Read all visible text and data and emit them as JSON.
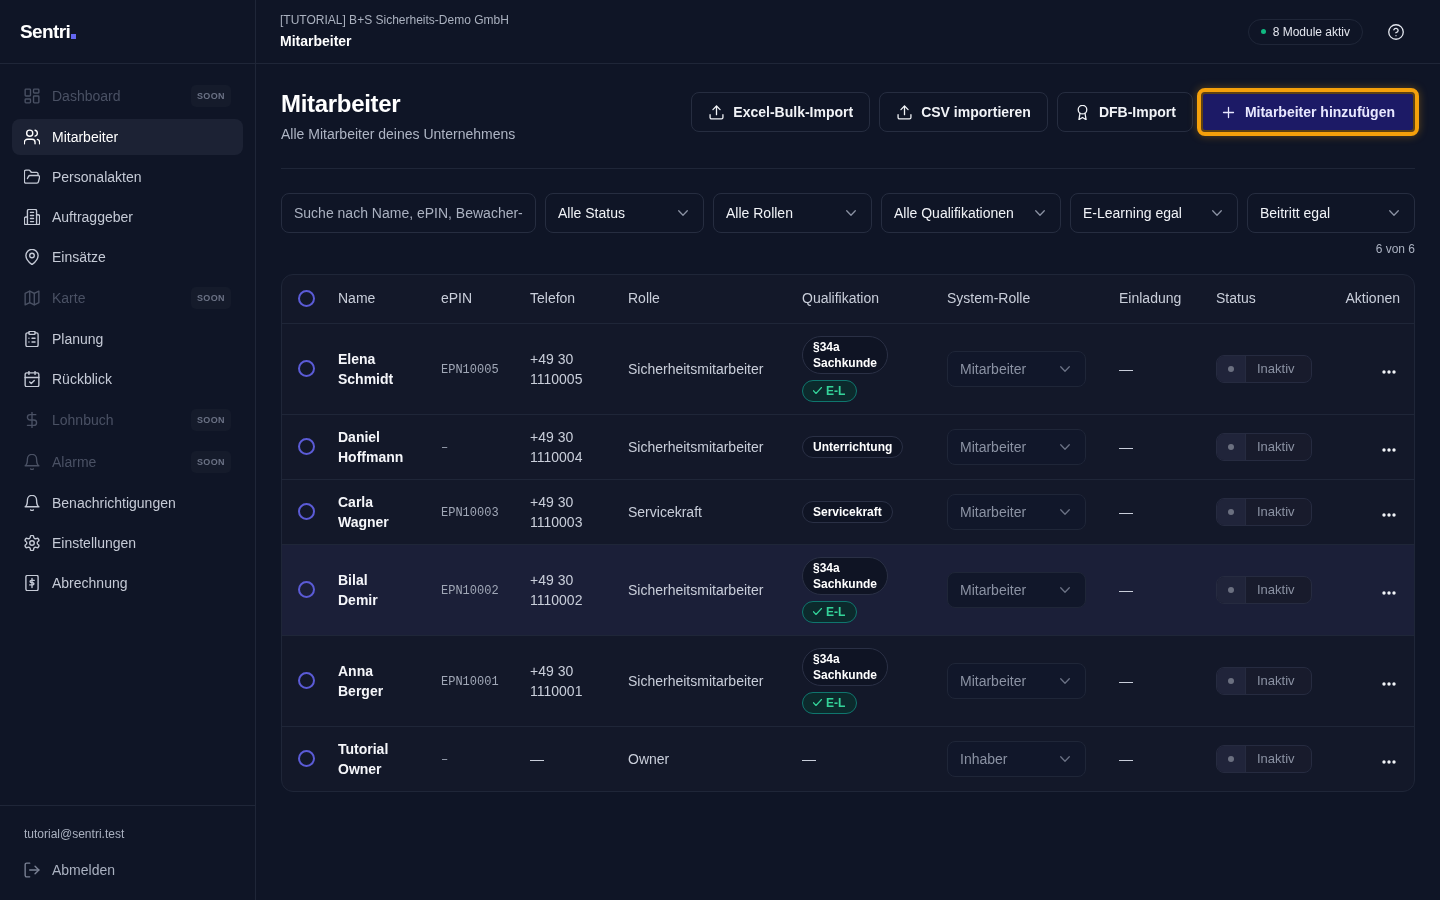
{
  "sidebar": {
    "logo": "Sentri",
    "items": [
      {
        "label": "Dashboard",
        "selected": false,
        "disabled": true,
        "badge": "SOON"
      },
      {
        "label": "Mitarbeiter",
        "selected": true,
        "disabled": false
      },
      {
        "label": "Personalakten",
        "selected": false,
        "disabled": false
      },
      {
        "label": "Auftraggeber",
        "selected": false,
        "disabled": false
      },
      {
        "label": "Einsätze",
        "selected": false,
        "disabled": false
      },
      {
        "label": "Karte",
        "selected": false,
        "disabled": true,
        "badge": "SOON"
      },
      {
        "label": "Planung",
        "selected": false,
        "disabled": false
      },
      {
        "label": "Rückblick",
        "selected": false,
        "disabled": false
      },
      {
        "label": "Lohnbuch",
        "selected": false,
        "disabled": true,
        "badge": "SOON"
      },
      {
        "label": "Alarme",
        "selected": false,
        "disabled": true,
        "badge": "SOON"
      },
      {
        "label": "Benachrichtigungen",
        "selected": false,
        "disabled": false
      },
      {
        "label": "Einstellungen",
        "selected": false,
        "disabled": false
      },
      {
        "label": "Abrechnung",
        "selected": false,
        "disabled": false
      }
    ],
    "user_email": "tutorial@sentri.test",
    "logout": "Abmelden"
  },
  "topbar": {
    "company": "[TUTORIAL] B+S Sicherheits-Demo GmbH",
    "breadcrumb": "Mitarbeiter",
    "modules": "8 Module aktiv"
  },
  "page": {
    "title": "Mitarbeiter",
    "subtitle": "Alle Mitarbeiter deines Unternehmens",
    "actions": [
      {
        "label": "Excel-Bulk-Import",
        "kind": "outline",
        "focused": false
      },
      {
        "label": "CSV importieren",
        "kind": "outline",
        "focused": false
      },
      {
        "label": "DFB-Import",
        "kind": "outline",
        "focused": false
      },
      {
        "label": "Mitarbeiter hinzufügen",
        "kind": "primary",
        "focused": true
      }
    ]
  },
  "filters": {
    "search": {
      "placeholder": "Suche nach Name, ePIN, Bewacher-"
    },
    "selects": [
      "Alle Status",
      "Alle Rollen",
      "Alle Qualifikationen",
      "E-Learning egal",
      "Beitritt egal"
    ],
    "count": "6 von 6"
  },
  "table": {
    "select_all": {
      "checked": false
    },
    "columns": [
      "Name",
      "ePIN",
      "Telefon",
      "Rolle",
      "Qualifikation",
      "System-Rolle",
      "Einladung",
      "Status",
      "Aktionen"
    ],
    "rows": [
      {
        "checked": false,
        "hovered": false,
        "name": "Elena Schmidt",
        "epin": "EPN10005",
        "phone": "+49 30 1110005",
        "role": "Sicherheitsmitarbeiter",
        "qualifications": [
          {
            "kind": "tag",
            "label": "§34a Sachkunde"
          },
          {
            "kind": "elearning",
            "label": "E-L"
          }
        ],
        "system_role": "Mitarbeiter",
        "invitation": "—",
        "status": "Inaktiv",
        "active": false
      },
      {
        "checked": false,
        "hovered": false,
        "name": "Daniel Hoffmann",
        "epin": "–",
        "phone": "+49 30 1110004",
        "role": "Sicherheitsmitarbeiter",
        "qualifications": [
          {
            "kind": "tag",
            "label": "Unterrichtung"
          }
        ],
        "system_role": "Mitarbeiter",
        "invitation": "—",
        "status": "Inaktiv",
        "active": false
      },
      {
        "checked": false,
        "hovered": false,
        "name": "Carla Wagner",
        "epin": "EPN10003",
        "phone": "+49 30 1110003",
        "role": "Servicekraft",
        "qualifications": [
          {
            "kind": "tag",
            "label": "Servicekraft"
          }
        ],
        "system_role": "Mitarbeiter",
        "invitation": "—",
        "status": "Inaktiv",
        "active": false
      },
      {
        "checked": false,
        "hovered": true,
        "name": "Bilal Demir",
        "epin": "EPN10002",
        "phone": "+49 30 1110002",
        "role": "Sicherheitsmitarbeiter",
        "qualifications": [
          {
            "kind": "tag",
            "label": "§34a Sachkunde"
          },
          {
            "kind": "elearning",
            "label": "E-L"
          }
        ],
        "system_role": "Mitarbeiter",
        "invitation": "—",
        "status": "Inaktiv",
        "active": false
      },
      {
        "checked": false,
        "hovered": false,
        "name": "Anna Berger",
        "epin": "EPN10001",
        "phone": "+49 30 1110001",
        "role": "Sicherheitsmitarbeiter",
        "qualifications": [
          {
            "kind": "tag",
            "label": "§34a Sachkunde"
          },
          {
            "kind": "elearning",
            "label": "E-L"
          }
        ],
        "system_role": "Mitarbeiter",
        "invitation": "—",
        "status": "Inaktiv",
        "active": false
      },
      {
        "checked": false,
        "hovered": false,
        "name": "Tutorial Owner",
        "epin": "–",
        "phone": "—",
        "role": "Owner",
        "qualifications": [
          {
            "kind": "none",
            "label": "—"
          }
        ],
        "system_role": "Inhaber",
        "invitation": "—",
        "status": "Inaktiv",
        "active": false
      }
    ]
  }
}
